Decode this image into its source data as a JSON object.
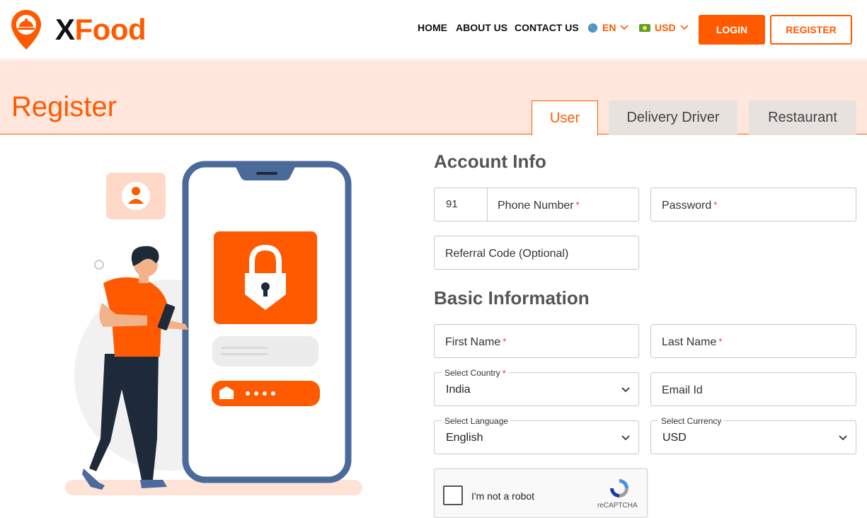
{
  "header": {
    "logo_x": "X",
    "logo_rest": "Food",
    "nav": [
      "HOME",
      "ABOUT US",
      "CONTACT US"
    ],
    "language": "EN",
    "currency": "USD",
    "login": "LOGIN",
    "register": "REGISTER"
  },
  "banner": {
    "title": "Register",
    "tabs": [
      {
        "label": "User",
        "active": true
      },
      {
        "label": "Delivery Driver",
        "active": false
      },
      {
        "label": "Restaurant",
        "active": false
      }
    ]
  },
  "account_info": {
    "title": "Account Info",
    "country_code": "91",
    "phone_placeholder": "Phone Number",
    "password_placeholder": "Password",
    "referral_placeholder": "Referral Code (Optional)",
    "required_mark": "*"
  },
  "basic_info": {
    "title": "Basic Information",
    "first_name": "First Name",
    "last_name": "Last Name",
    "country_label": "Select Country",
    "country_value": "India",
    "email_placeholder": "Email Id",
    "language_label": "Select Language",
    "language_value": "English",
    "currency_label": "Select Currency",
    "currency_value": "USD"
  },
  "captcha": {
    "label": "I'm not a robot",
    "brand": "reCAPTCHA"
  },
  "colors": {
    "accent": "#ff5a00",
    "banner_bg": "#ffe7dd",
    "tab_inactive": "#e8e2df",
    "illustration_phone": "#4a6a9a"
  }
}
